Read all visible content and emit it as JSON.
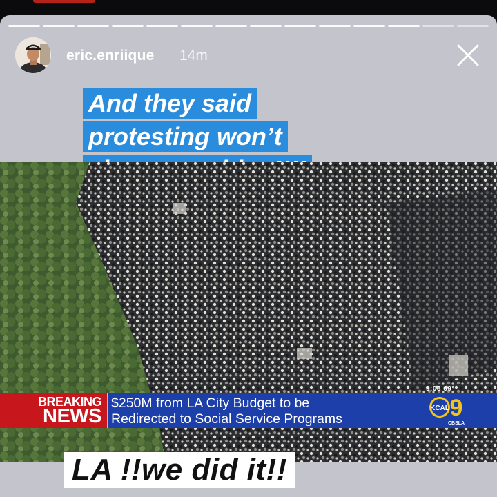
{
  "story": {
    "username": "eric.enriique",
    "time_ago": "14m",
    "close_icon": "close-icon",
    "segments_total": 14,
    "segments_viewed": 12
  },
  "captions": {
    "top_lines": [
      "And they said",
      "protesting won’t",
      "change nothing!!!!"
    ],
    "bottom": "LA !!we did it!!"
  },
  "news": {
    "breaking_label_1": "BREAKING",
    "breaking_label_2": "NEWS",
    "headline_1": "$250M from LA City Budget to be",
    "headline_2": "Redirected to Social Service Programs",
    "time_temp": "9:08  69°",
    "station_logo_text": "KCAL",
    "station_number": "9",
    "station_handle": "CBSLA"
  },
  "colors": {
    "caption_highlight": "#2a8cdc",
    "breaking_red": "#c8161d",
    "headline_blue": "#1d3fa9",
    "accent_yellow": "#f1c31c"
  }
}
